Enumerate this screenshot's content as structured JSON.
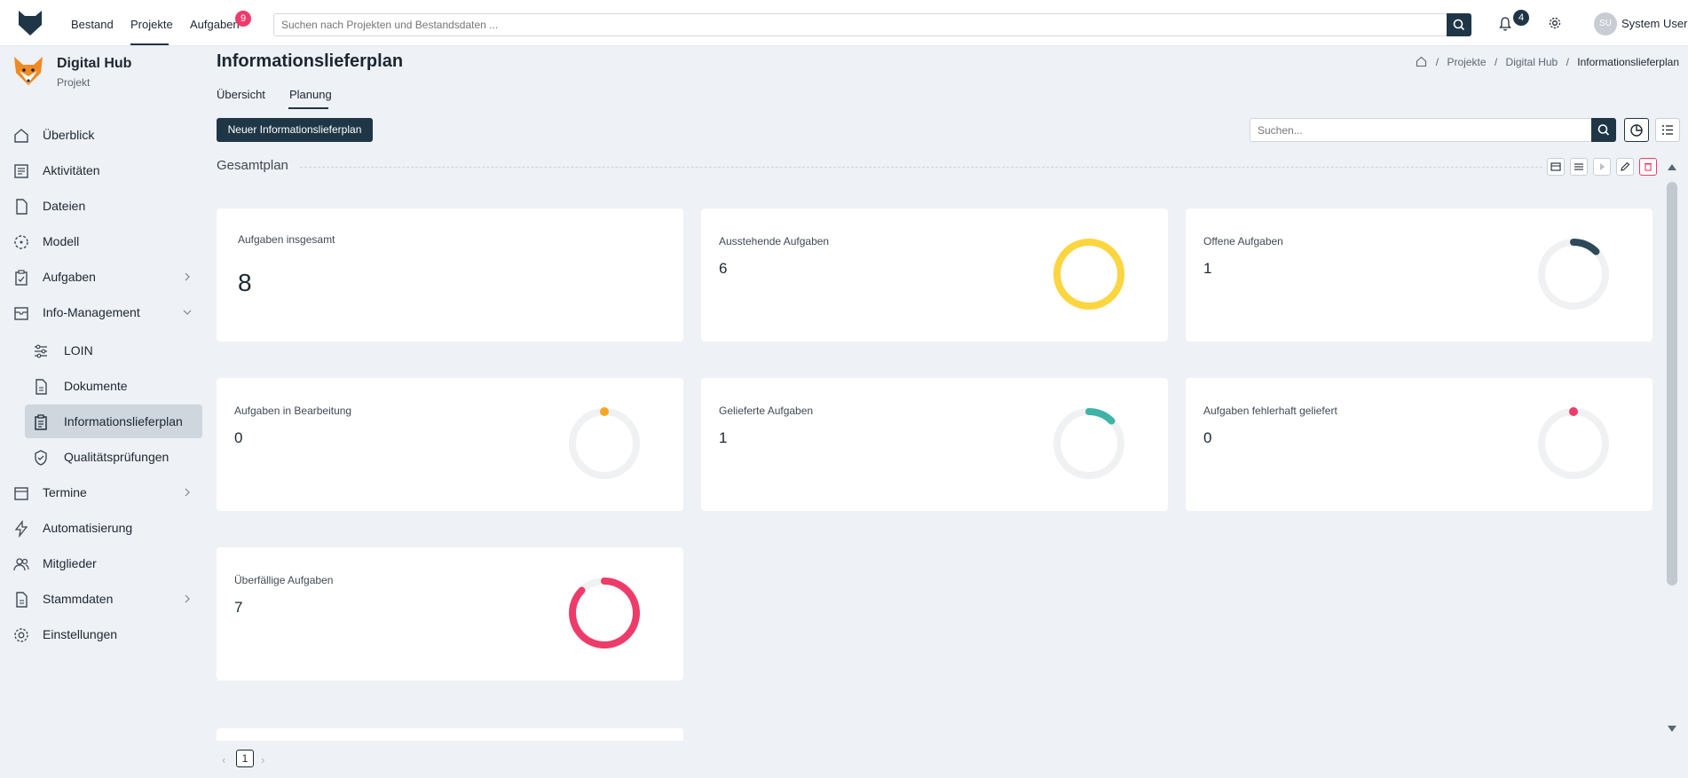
{
  "topnav": {
    "items": [
      {
        "label": "Bestand"
      },
      {
        "label": "Projekte"
      },
      {
        "label": "Aufgaben",
        "badge": "9"
      }
    ],
    "search_placeholder": "Suchen nach Projekten und Bestandsdaten ...",
    "notifications_count": "4",
    "user_initials": "SU",
    "user_name": "System User"
  },
  "project": {
    "name": "Digital Hub",
    "type": "Projekt"
  },
  "sidebar": {
    "items": [
      {
        "label": "Überblick",
        "icon": "home-icon"
      },
      {
        "label": "Aktivitäten",
        "icon": "activity-icon"
      },
      {
        "label": "Dateien",
        "icon": "file-icon"
      },
      {
        "label": "Modell",
        "icon": "model-icon"
      },
      {
        "label": "Aufgaben",
        "icon": "tasks-icon"
      },
      {
        "label": "Info-Management",
        "icon": "inbox-icon"
      },
      {
        "label": "Termine",
        "icon": "calendar-icon"
      },
      {
        "label": "Automatisierung",
        "icon": "lightning-icon"
      },
      {
        "label": "Mitglieder",
        "icon": "users-icon"
      },
      {
        "label": "Stammdaten",
        "icon": "document-icon"
      },
      {
        "label": "Einstellungen",
        "icon": "gear-icon"
      }
    ],
    "subitems": [
      {
        "label": "LOIN",
        "icon": "sliders-icon"
      },
      {
        "label": "Dokumente",
        "icon": "document-icon"
      },
      {
        "label": "Informationslieferplan",
        "icon": "clipboard-icon"
      },
      {
        "label": "Qualitätsprüfungen",
        "icon": "shield-check-icon"
      }
    ]
  },
  "page": {
    "title": "Informationslieferplan",
    "breadcrumb": [
      "Projekte",
      "Digital Hub",
      "Informationslieferplan"
    ],
    "tabs": [
      "Übersicht",
      "Planung"
    ],
    "new_button": "Neuer Informationslieferplan",
    "search_placeholder": "Suchen...",
    "section_title": "Gesamtplan"
  },
  "cards": [
    {
      "title": "Aufgaben insgesamt",
      "value": "8"
    },
    {
      "title": "Ausstehende Aufgaben",
      "value": "6",
      "fraction": 1.0,
      "color": "#fcd53f"
    },
    {
      "title": "Offene Aufgaben",
      "value": "1",
      "fraction": 0.125,
      "color": "#2d4a5a"
    },
    {
      "title": "Aufgaben in Bearbeitung",
      "value": "0",
      "fraction": 0,
      "color": "#f5a623"
    },
    {
      "title": "Gelieferte Aufgaben",
      "value": "1",
      "fraction": 0.125,
      "color": "#3fb3a8"
    },
    {
      "title": "Aufgaben fehlerhaft geliefert",
      "value": "0",
      "fraction": 0,
      "color": "#ee3c6a"
    },
    {
      "title": "Überfällige Aufgaben",
      "value": "7",
      "fraction": 0.875,
      "color": "#ee3c6a"
    }
  ],
  "pagination": {
    "current": "1",
    "prev": "‹",
    "next": "›"
  },
  "colors": {
    "primary": "#1f3647",
    "badge": "#ee3c6a",
    "background": "#eef1f5",
    "track": "#f0f1f2"
  }
}
